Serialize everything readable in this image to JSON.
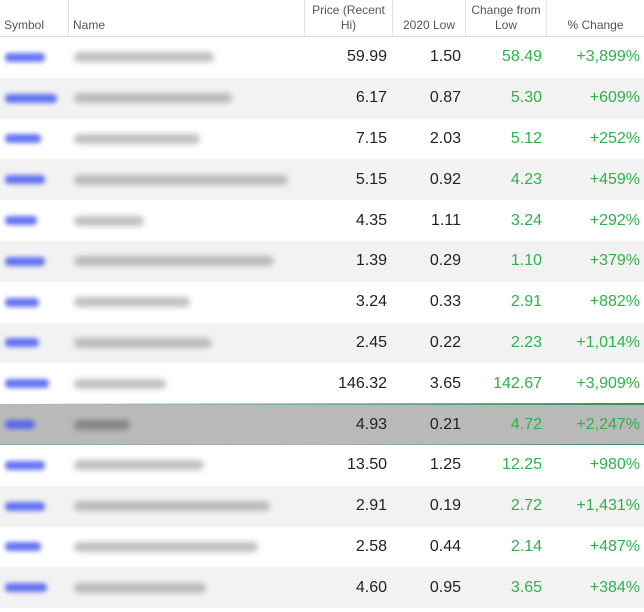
{
  "headers": {
    "symbol": "Symbol",
    "name": "Name",
    "price": "Price (Recent Hi)",
    "low2020": "2020 Low",
    "change": "Change from Low",
    "pct_change": "% Change"
  },
  "colors": {
    "positive": "#2db24a",
    "link": "#4a5cf0",
    "selected_row": "#b9b9b9",
    "stripe": "#f2f2f2"
  },
  "rows": [
    {
      "price": "59.99",
      "low": "1.50",
      "change": "58.49",
      "pct": "+3,899%"
    },
    {
      "price": "6.17",
      "low": "0.87",
      "change": "5.30",
      "pct": "+609%"
    },
    {
      "price": "7.15",
      "low": "2.03",
      "change": "5.12",
      "pct": "+252%"
    },
    {
      "price": "5.15",
      "low": "0.92",
      "change": "4.23",
      "pct": "+459%"
    },
    {
      "price": "4.35",
      "low": "1.11",
      "change": "3.24",
      "pct": "+292%"
    },
    {
      "price": "1.39",
      "low": "0.29",
      "change": "1.10",
      "pct": "+379%"
    },
    {
      "price": "3.24",
      "low": "0.33",
      "change": "2.91",
      "pct": "+882%"
    },
    {
      "price": "2.45",
      "low": "0.22",
      "change": "2.23",
      "pct": "+1,014%"
    },
    {
      "price": "146.32",
      "low": "3.65",
      "change": "142.67",
      "pct": "+3,909%"
    },
    {
      "price": "4.93",
      "low": "0.21",
      "change": "4.72",
      "pct": "+2,247%"
    },
    {
      "price": "13.50",
      "low": "1.25",
      "change": "12.25",
      "pct": "+980%"
    },
    {
      "price": "2.91",
      "low": "0.19",
      "change": "2.72",
      "pct": "+1,431%"
    },
    {
      "price": "2.58",
      "low": "0.44",
      "change": "2.14",
      "pct": "+487%"
    },
    {
      "price": "4.60",
      "low": "0.95",
      "change": "3.65",
      "pct": "+384%"
    }
  ]
}
